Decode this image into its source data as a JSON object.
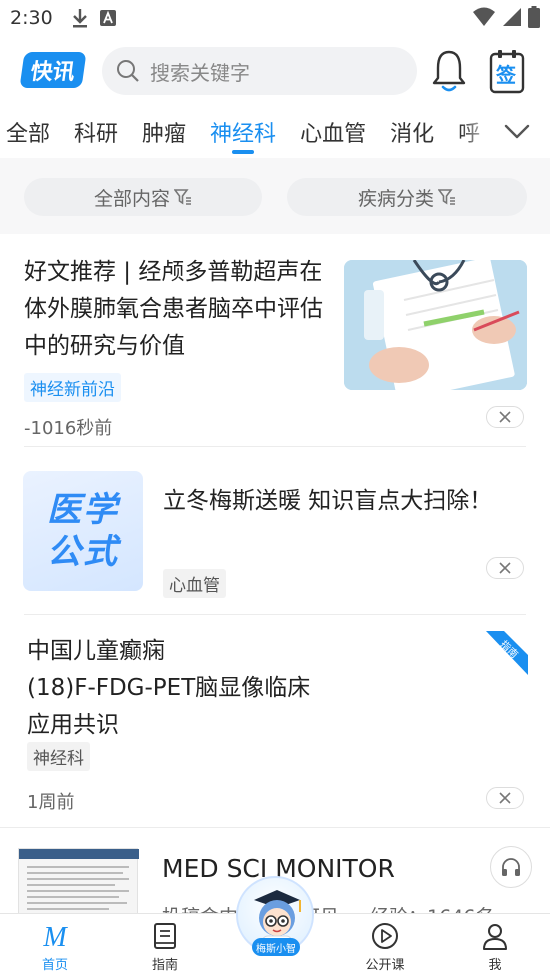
{
  "status_bar": {
    "time": "2:30"
  },
  "header": {
    "logo_text": "快讯",
    "search_placeholder": "搜索关键字",
    "sign_label": "签"
  },
  "tabs": [
    {
      "label": "全部",
      "active": false
    },
    {
      "label": "科研",
      "active": false
    },
    {
      "label": "肿瘤",
      "active": false
    },
    {
      "label": "神经科",
      "active": true
    },
    {
      "label": "心血管",
      "active": false
    },
    {
      "label": "消化",
      "active": false
    },
    {
      "label": "呼",
      "active": false
    }
  ],
  "filters": {
    "content": "全部内容",
    "disease": "疾病分类"
  },
  "feed": [
    {
      "title": "好文推荐 | 经颅多普勒超声在体外膜肺氧合患者脑卒中评估中的研究与价值",
      "tag": "神经新前沿",
      "time": "-1016秒前"
    },
    {
      "title": "立冬梅斯送暖 知识盲点大扫除！",
      "tag": "心血管",
      "thumb_text_1": "医学",
      "thumb_text_2": "公式"
    },
    {
      "title_line1": "中国儿童癫痫",
      "title_line2": "(18)F-FDG-PET脑显像临床",
      "title_line3": "应用共识",
      "tag": "神经科",
      "time": "1周前",
      "ribbon": "指南"
    },
    {
      "title": "MED SCI MONITOR",
      "subtitle": "投稿命中率：… 可见 … 经验：1646名"
    }
  ],
  "mascot": {
    "label": "梅斯小智"
  },
  "bottom_nav": [
    {
      "label": "首页",
      "active": true
    },
    {
      "label": "指南",
      "active": false
    },
    {
      "label": "公开课",
      "active": false
    },
    {
      "label": "我",
      "active": false
    }
  ],
  "colors": {
    "accent": "#1a8ff0",
    "text": "#222222",
    "muted": "#666666",
    "filter_bg": "#f7f7f8"
  }
}
